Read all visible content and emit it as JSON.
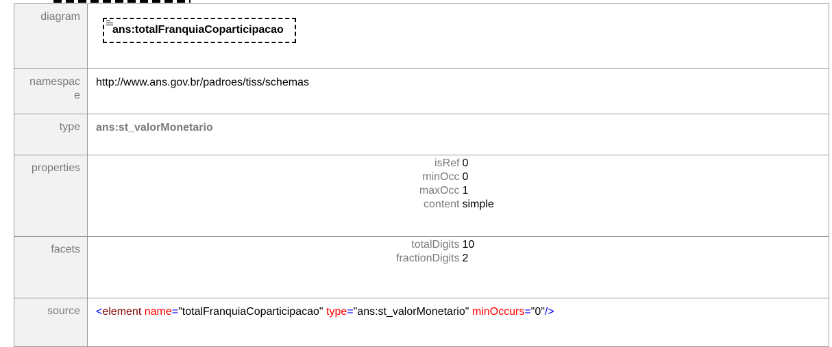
{
  "rows": {
    "diagram": {
      "label": "diagram",
      "element_name": "ans:totalFranquiaCoparticipacao",
      "icon": "documentation-lines-icon"
    },
    "namespace": {
      "label": "namespac\ne",
      "value": "http://www.ans.gov.br/padroes/tiss/schemas"
    },
    "type": {
      "label": "type",
      "value": "ans:st_valorMonetario"
    },
    "properties": {
      "label": "properties",
      "items": [
        {
          "key": "isRef",
          "value": "0"
        },
        {
          "key": "minOcc",
          "value": "0"
        },
        {
          "key": "maxOcc",
          "value": "1"
        },
        {
          "key": "content",
          "value": "simple"
        }
      ]
    },
    "facets": {
      "label": "facets",
      "items": [
        {
          "key": "totalDigits",
          "value": "10"
        },
        {
          "key": "fractionDigits",
          "value": "2"
        }
      ]
    },
    "source": {
      "label": "source",
      "open": "<",
      "tag": "element",
      "attr1_name": "name",
      "attr1_value": "\"totalFranquiaCoparticipacao\"",
      "attr2_name": "type",
      "attr2_value": "\"ans:st_valorMonetario\"",
      "attr3_name": "minOccurs",
      "attr3_value": "\"0\"",
      "close": "/>"
    }
  },
  "colors": {
    "label_bg": "#f2f2f2",
    "label_text": "#7a7a7a",
    "xml_bracket": "#0000ff",
    "xml_tag": "#800000",
    "xml_attr": "#ff0000"
  }
}
